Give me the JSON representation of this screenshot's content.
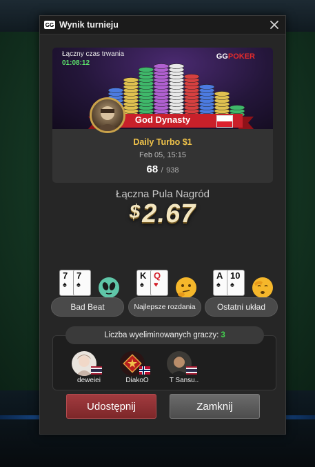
{
  "window": {
    "title": "Wynik turnieju"
  },
  "banner": {
    "time_label": "Łączny czas trwania",
    "time_value": "01:08:12",
    "brand_gg": "GG",
    "brand_poker": "POKER",
    "player_name": "God Dynasty",
    "player_flag": "poland-flag"
  },
  "tournament": {
    "name": "Daily Turbo $1",
    "date": "Feb 05, 15:15",
    "position": "68",
    "separator": "/",
    "total_players": "938"
  },
  "prize": {
    "label": "Łączna Pula Nagród",
    "currency": "$",
    "amount": "2.67"
  },
  "hands": [
    {
      "label": "Bad Beat",
      "cards": [
        {
          "rank": "7",
          "suit": "♠",
          "red": false
        },
        {
          "rank": "7",
          "suit": "♠",
          "red": false
        }
      ],
      "emoji": "alien-emoji-icon"
    },
    {
      "label": "Najlepsze rozdania",
      "cards": [
        {
          "rank": "K",
          "suit": "♠",
          "red": false
        },
        {
          "rank": "Q",
          "suit": "♥",
          "red": true
        }
      ],
      "emoji": "thinking-emoji-icon"
    },
    {
      "label": "Ostatni układ",
      "cards": [
        {
          "rank": "A",
          "suit": "♠",
          "red": false
        },
        {
          "rank": "10",
          "suit": "♠",
          "red": false
        }
      ],
      "emoji": "facepalm-emoji-icon"
    }
  ],
  "eliminated": {
    "label": "Liczba wyeliminowanych graczy:",
    "count": "3",
    "players": [
      {
        "name": "deweiei",
        "flag": "thailand-flag"
      },
      {
        "name": "DiakoO",
        "flag": "norway-flag"
      },
      {
        "name": "T Sansu..",
        "flag": "thailand-flag"
      }
    ]
  },
  "buttons": {
    "share": "Udostępnij",
    "close": "Zamknij"
  },
  "colors": {
    "accent_gold": "#f0c34a",
    "ribbon_red": "#c9202a",
    "count_green": "#44d44f",
    "timer_green": "#5be06a",
    "share_red": "#a23b3f"
  }
}
